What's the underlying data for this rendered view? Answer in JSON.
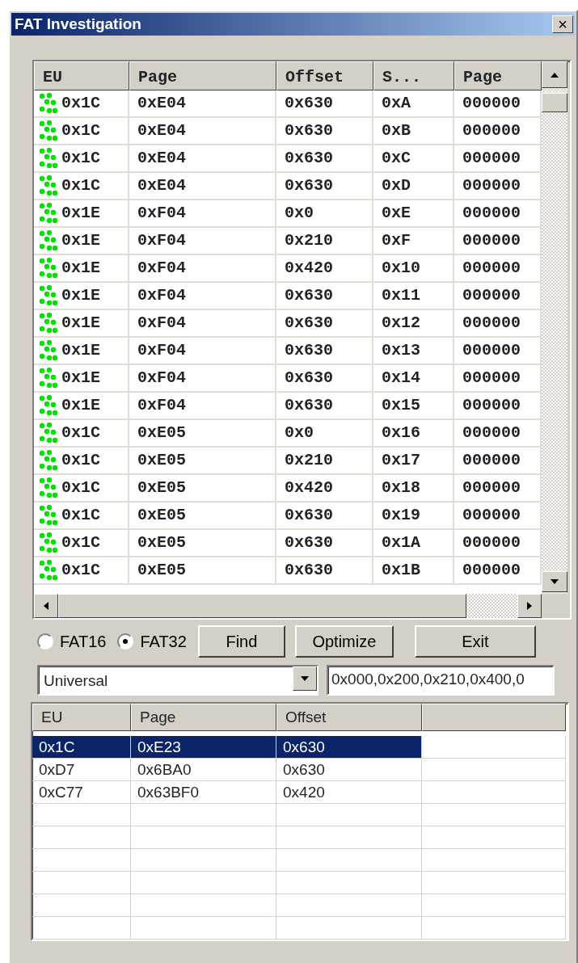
{
  "window": {
    "title": "FAT Investigation",
    "close": "×"
  },
  "top_table": {
    "columns": [
      "EU",
      "Page",
      "Offset",
      "S...",
      "Page"
    ],
    "rows": [
      [
        "0x1C",
        "0xE04",
        "0x630",
        "0xA",
        "000000"
      ],
      [
        "0x1C",
        "0xE04",
        "0x630",
        "0xB",
        "000000"
      ],
      [
        "0x1C",
        "0xE04",
        "0x630",
        "0xC",
        "000000"
      ],
      [
        "0x1C",
        "0xE04",
        "0x630",
        "0xD",
        "000000"
      ],
      [
        "0x1E",
        "0xF04",
        "0x0",
        "0xE",
        "000000"
      ],
      [
        "0x1E",
        "0xF04",
        "0x210",
        "0xF",
        "000000"
      ],
      [
        "0x1E",
        "0xF04",
        "0x420",
        "0x10",
        "000000"
      ],
      [
        "0x1E",
        "0xF04",
        "0x630",
        "0x11",
        "000000"
      ],
      [
        "0x1E",
        "0xF04",
        "0x630",
        "0x12",
        "000000"
      ],
      [
        "0x1E",
        "0xF04",
        "0x630",
        "0x13",
        "000000"
      ],
      [
        "0x1E",
        "0xF04",
        "0x630",
        "0x14",
        "000000"
      ],
      [
        "0x1E",
        "0xF04",
        "0x630",
        "0x15",
        "000000"
      ],
      [
        "0x1C",
        "0xE05",
        "0x0",
        "0x16",
        "000000"
      ],
      [
        "0x1C",
        "0xE05",
        "0x210",
        "0x17",
        "000000"
      ],
      [
        "0x1C",
        "0xE05",
        "0x420",
        "0x18",
        "000000"
      ],
      [
        "0x1C",
        "0xE05",
        "0x630",
        "0x19",
        "000000"
      ],
      [
        "0x1C",
        "0xE05",
        "0x630",
        "0x1A",
        "000000"
      ],
      [
        "0x1C",
        "0xE05",
        "0x630",
        "0x1B",
        "000000"
      ]
    ]
  },
  "fat_type": [
    {
      "label": "FAT16",
      "selected": false
    },
    {
      "label": "FAT32",
      "selected": true
    }
  ],
  "buttons": [
    "Find",
    "Optimize",
    "Exit"
  ],
  "mode_combo": {
    "value": "Universal"
  },
  "offsets_field": {
    "value": "0x000,0x200,0x210,0x400,0"
  },
  "bottom_table": {
    "columns": [
      "EU",
      "Page",
      "Offset"
    ],
    "rows": [
      {
        "cells": [
          "0x1C",
          "0xE23",
          "0x630"
        ],
        "selected": true
      },
      {
        "cells": [
          "0xD7",
          "0x6BA0",
          "0x630"
        ],
        "selected": false
      },
      {
        "cells": [
          "0xC77",
          "0x63BF0",
          "0x420"
        ],
        "selected": false
      }
    ]
  }
}
